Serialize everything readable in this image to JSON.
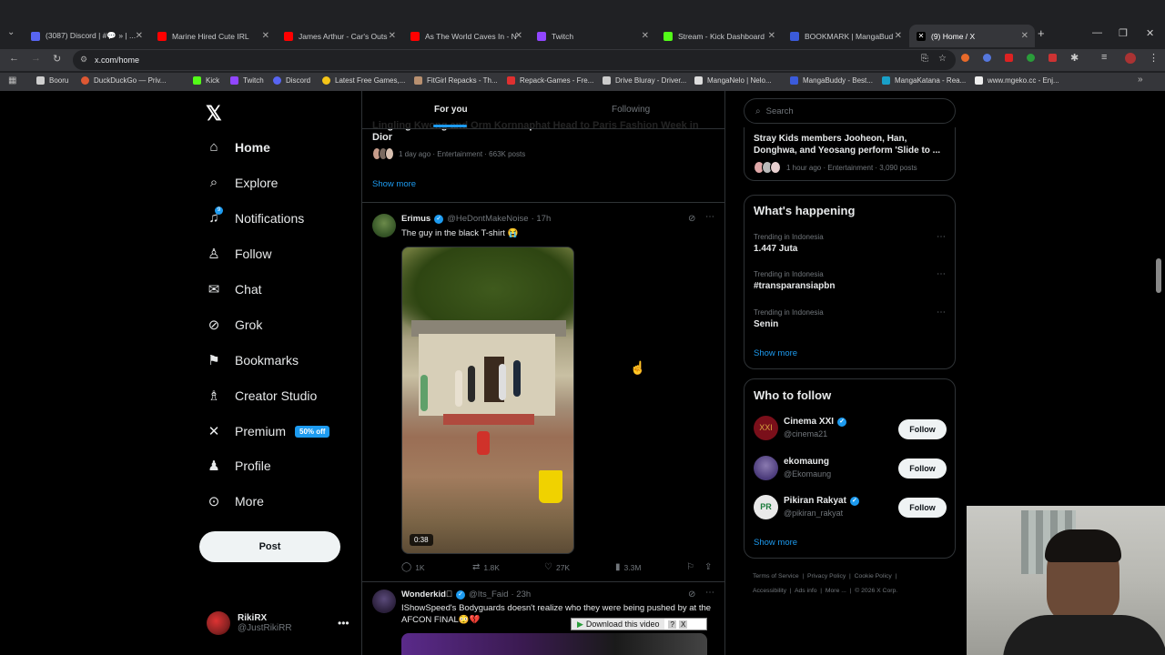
{
  "browser": {
    "tabs": [
      {
        "title": "(3087) Discord | #💬 » | ...",
        "color": "#5865f2",
        "active": false
      },
      {
        "title": "Marine Hired Cute IRL",
        "color": "#ff0000",
        "active": false
      },
      {
        "title": "James Arthur - Car's Outs",
        "color": "#ff0000",
        "active": false
      },
      {
        "title": "As The World Caves In - N",
        "color": "#ff0000",
        "active": false
      },
      {
        "title": "Twitch",
        "color": "#9146ff",
        "active": false
      },
      {
        "title": "Stream - Kick Dashboard",
        "color": "#53fc18",
        "active": false
      },
      {
        "title": "BOOKMARK | MangaBud",
        "color": "#3b5bdb",
        "active": false
      },
      {
        "title": "(9) Home / X",
        "color": "#ffffff",
        "active": true
      }
    ],
    "url": "x.com/home",
    "bookmarks": [
      {
        "label": "Booru",
        "color": "#cfcfcf"
      },
      {
        "label": "DuckDuckGo — Priv...",
        "color": "#de5833"
      },
      {
        "label": "Kick",
        "color": "#53fc18"
      },
      {
        "label": "Twitch",
        "color": "#9146ff"
      },
      {
        "label": "Discord",
        "color": "#5865f2"
      },
      {
        "label": "Latest Free Games,...",
        "color": "#f5c518"
      },
      {
        "label": "FitGirl Repacks - Th...",
        "color": "#b89070"
      },
      {
        "label": "Repack-Games - Fre...",
        "color": "#e03030"
      },
      {
        "label": "Drive Bluray - Driver...",
        "color": "#cccccc"
      },
      {
        "label": "MangaNelo | Nelo...",
        "color": "#dddddd"
      },
      {
        "label": "MangaBuddy - Best...",
        "color": "#3b5bdb"
      },
      {
        "label": "MangaKatana - Rea...",
        "color": "#19a0c8"
      },
      {
        "label": "www.mgeko.cc - Enj...",
        "color": "#eeeeee"
      }
    ]
  },
  "nav": {
    "items": [
      {
        "label": "Home",
        "icon": "home-icon",
        "glyph": "⌂"
      },
      {
        "label": "Explore",
        "icon": "search-icon",
        "glyph": "⌕"
      },
      {
        "label": "Notifications",
        "icon": "bell-icon",
        "glyph": "♫"
      },
      {
        "label": "Follow",
        "icon": "person-add-icon",
        "glyph": "♙"
      },
      {
        "label": "Chat",
        "icon": "mail-icon",
        "glyph": "✉"
      },
      {
        "label": "Grok",
        "icon": "grok-icon",
        "glyph": "⊘"
      },
      {
        "label": "Bookmarks",
        "icon": "bookmark-icon",
        "glyph": "⚑"
      },
      {
        "label": "Creator Studio",
        "icon": "creator-icon",
        "glyph": "♗"
      },
      {
        "label": "Premium",
        "icon": "x-premium-icon",
        "glyph": "✕"
      },
      {
        "label": "Profile",
        "icon": "person-icon",
        "glyph": "♟"
      },
      {
        "label": "More",
        "icon": "more-circle-icon",
        "glyph": "⊙"
      }
    ],
    "premium_badge": "50% off",
    "post_label": "Post",
    "notification_count": "9"
  },
  "account": {
    "name": "RikiRX",
    "handle": "@JustRikiRR"
  },
  "feed": {
    "tabs": [
      "For you",
      "Following"
    ],
    "top_trend_title": "Lingling Kwong and Orm Kornnaphat Head to Paris Fashion Week in Dior",
    "top_trend_meta": "1 day ago · Entertainment · 663K posts",
    "show_more": "Show more",
    "tweet1": {
      "name": "Erimus",
      "handle": "@HeDontMakeNoise",
      "time": "· 17h",
      "text": "The guy in the black T-shirt 😭",
      "duration": "0:38",
      "replies": "1K",
      "reposts": "1.8K",
      "likes": "27K",
      "views": "3.3M"
    },
    "tweet2": {
      "name": "Wonderkid🏽",
      "handle": "@Its_Faid",
      "time": "· 23h",
      "text": "IShowSpeed's Bodyguards doesn't realize who they were being pushed by at the AFCON FINAL😳💔"
    },
    "download_label": "Download this video",
    "download_help": "?",
    "download_close": "X"
  },
  "sidebar": {
    "search_placeholder": "Search",
    "top_trend": {
      "title": "Stray Kids members Jooheon, Han, Donghwa, and Yeosang perform 'Slide to ...",
      "meta": "1 hour ago · Entertainment · 3,090 posts"
    },
    "whats_happening": "What's happening",
    "trends": [
      {
        "label": "Trending in Indonesia",
        "name": "1.447 Juta"
      },
      {
        "label": "Trending in Indonesia",
        "name": "#transparansiapbn"
      },
      {
        "label": "Trending in Indonesia",
        "name": "Senin"
      }
    ],
    "show_more": "Show more",
    "who_to_follow": "Who to follow",
    "follow_label": "Follow",
    "suggestions": [
      {
        "name": "Cinema XXI",
        "handle": "@cinema21",
        "verified": true,
        "color": "#7a0f1a"
      },
      {
        "name": "ekomaung",
        "handle": "@Ekomaung",
        "verified": false,
        "color": "#5a4a8a"
      },
      {
        "name": "Pikiran Rakyat",
        "handle": "@pikiran_rakyat",
        "verified": true,
        "color": "#e9e9e9"
      }
    ],
    "footer": [
      "Terms of Service",
      "Privacy Policy",
      "Cookie Policy",
      "Accessibility",
      "Ads info",
      "More ...",
      "© 2026 X Corp."
    ]
  }
}
